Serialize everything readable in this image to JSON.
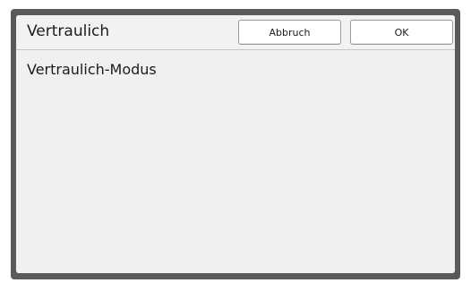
{
  "dialog": {
    "title": "Vertraulich",
    "cancel_label": "Abbruch",
    "ok_label": "OK"
  },
  "content": {
    "mode_label": "Vertraulich-Modus"
  }
}
